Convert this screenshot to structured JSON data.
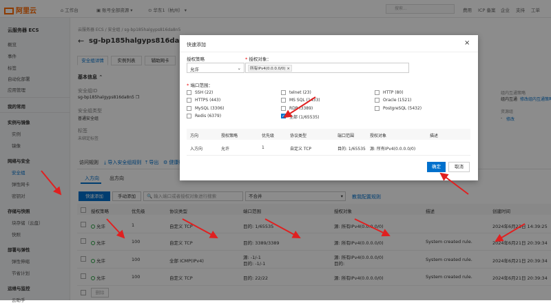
{
  "topbar": {
    "logo": "阿里云",
    "workbench": "工作台",
    "acct": "账号全部资源",
    "region": "华东1（杭州）",
    "search_placeholder": "搜索...",
    "links": [
      "费用",
      "ICP 备案",
      "企业",
      "支持",
      "工单"
    ]
  },
  "sidebar": {
    "title": "云服务器 ECS",
    "items": [
      "概览",
      "事件",
      "标签",
      "自动化部署",
      "应用管理",
      "我的常用",
      "实例与镜像",
      "实例",
      "镜像",
      "网络与安全",
      "安全组",
      "弹性网卡",
      "密钥对",
      "存储与快照",
      "块存储（云盘）",
      "快照",
      "部署与弹性",
      "弹性伸缩",
      "节省计划",
      "运维与监控",
      "云助手"
    ]
  },
  "page": {
    "breadcrumb": "云服务器 ECS / 安全组 / sg-bp185halgyps816da8n5",
    "title": "sg-bp185halgyps816da8",
    "tabs": [
      "安全组详情",
      "实例列表",
      "辅助网卡"
    ],
    "basic_info": "基本信息",
    "sgid_label": "安全组ID",
    "sgid": "sg-bp185halgyps816da8n5",
    "type_label": "安全组类型",
    "type": "普通安全组",
    "tag_label": "标签",
    "tag": "未绑定标签",
    "right_label1": "组内互通策略",
    "right_value1": "组内互通",
    "right_link": "修改组内互通策略",
    "right_label2": "资源组",
    "right_value2": "-",
    "right_change": "修改",
    "access_rule": "访问规则",
    "import": "导入安全组规则",
    "export": "导出",
    "health": "健康检查",
    "inbound": "入方向",
    "outbound": "出方向",
    "quick_add": "快速添加",
    "manual_add": "手动添加",
    "filter_placeholder": "输入端口或者授权对象进行搜索",
    "filter_select": "不合并",
    "config_link": "教我配置规则",
    "cols": [
      "授权策略",
      "优先级",
      "协议类型",
      "端口范围",
      "授权对象",
      "描述",
      "创建时间"
    ],
    "rows": [
      {
        "policy": "允许",
        "priority": "1",
        "proto": "自定义 TCP",
        "port": "目的: 1/65535",
        "target": "源: 所有IPv4(0.0.0.0/0)",
        "desc": "",
        "time": "2024年6月23日 14:39:25"
      },
      {
        "policy": "允许",
        "priority": "100",
        "proto": "自定义 TCP",
        "port": "目的: 3389/3389",
        "target": "源: 所有IPv4(0.0.0.0/0)",
        "desc": "System created rule.",
        "time": "2024年6月21日 20:39:34"
      },
      {
        "policy": "允许",
        "priority": "100",
        "proto": "全部 ICMP(IPv4)",
        "port": "源: -1/-1",
        "port2": "目的: -1/-1",
        "target": "源: 所有IPv4(0.0.0.0/0)",
        "target2": "目的:",
        "desc": "System created rule.",
        "time": "2024年6月21日 20:39:34"
      },
      {
        "policy": "允许",
        "priority": "100",
        "proto": "自定义 TCP",
        "port": "目的: 22/22",
        "target": "源: 所有IPv4(0.0.0.0/0)",
        "desc": "System created rule.",
        "time": "2024年6月21日 20:39:34"
      }
    ],
    "delete": "删除"
  },
  "modal": {
    "title": "快速添加",
    "policy_label": "授权策略",
    "policy_value": "允许",
    "target_label": "授权对象：",
    "target_tag": "所有IPv4(0.0.0.0/0)",
    "port_label": "端口范围：",
    "ports": [
      {
        "label": "SSH (22)",
        "checked": false
      },
      {
        "label": "telnet (23)",
        "checked": false
      },
      {
        "label": "HTTP (80)",
        "checked": false
      },
      {
        "label": "HTTPS (443)",
        "checked": false
      },
      {
        "label": "MS SQL (1433)",
        "checked": false
      },
      {
        "label": "Oracle (1521)",
        "checked": false
      },
      {
        "label": "MySQL (3306)",
        "checked": false
      },
      {
        "label": "RDP (3389)",
        "checked": false
      },
      {
        "label": "PostgreSQL (5432)",
        "checked": false
      },
      {
        "label": "Redis (6379)",
        "checked": false
      },
      {
        "label": "全部 (1/65535)",
        "checked": true
      }
    ],
    "table_cols": [
      "方向",
      "授权策略",
      "优先级",
      "协议类型",
      "端口范围",
      "授权对象",
      "描述"
    ],
    "table_row": [
      "入方向",
      "允许",
      "1",
      "自定义 TCP",
      "目的: 1/65535",
      "源: 所有IPv4(0.0.0.0/0)",
      ""
    ],
    "ok": "确定",
    "cancel": "取消",
    "close": "×"
  },
  "colors": {
    "accent": "#0070cc",
    "brand": "#ff6a00",
    "arrow": "#e02020"
  }
}
